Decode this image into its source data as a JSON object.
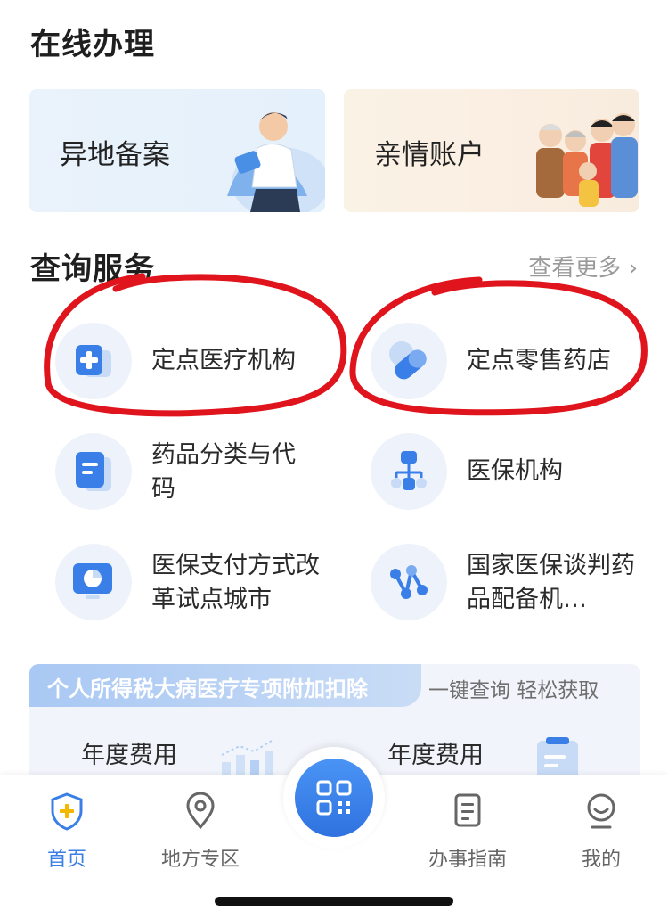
{
  "online": {
    "title": "在线办理",
    "cards": [
      {
        "label": "异地备案"
      },
      {
        "label": "亲情账户"
      }
    ]
  },
  "query": {
    "title": "查询服务",
    "more": "查看更多 ›",
    "items": [
      {
        "label": "定点医疗机构",
        "icon": "medical-institution-icon"
      },
      {
        "label": "定点零售药店",
        "icon": "pill-icon"
      },
      {
        "label": "药品分类与代码",
        "icon": "document-icon"
      },
      {
        "label": "医保机构",
        "icon": "org-chart-icon"
      },
      {
        "label": "医保支付方式改革试点城市",
        "icon": "pie-chart-icon"
      },
      {
        "label": "国家医保谈判药品配备机…",
        "icon": "network-icon"
      }
    ]
  },
  "tax": {
    "banner": "个人所得税大病医疗专项附加扣除",
    "side": "一键查询 轻松获取",
    "fee_left": "年度费用",
    "fee_right": "年度费用"
  },
  "tabbar": {
    "home": "首页",
    "local": "地方专区",
    "guide": "办事指南",
    "mine": "我的"
  },
  "colors": {
    "accent": "#3a7ee8",
    "annotation": "#e0141c"
  }
}
